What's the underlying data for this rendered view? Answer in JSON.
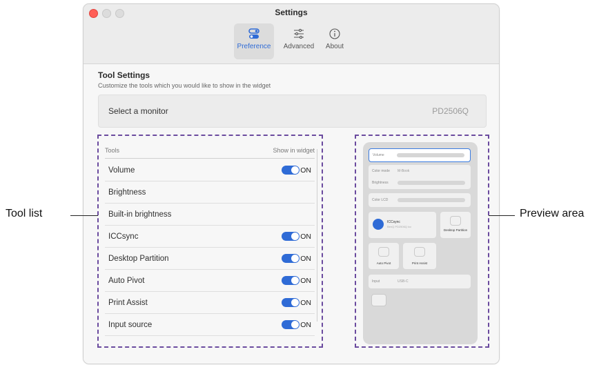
{
  "window": {
    "title": "Settings"
  },
  "tabs": [
    {
      "label": "Preference",
      "icon": "toggle-icon",
      "active": true
    },
    {
      "label": "Advanced",
      "icon": "sliders-icon",
      "active": false
    },
    {
      "label": "About",
      "icon": "info-icon",
      "active": false
    }
  ],
  "tool_settings": {
    "heading": "Tool Settings",
    "subtitle": "Customize the tools which you would like to show in the widget",
    "monitor_label": "Select a monitor",
    "monitor_value": "PD2506Q"
  },
  "tool_list": {
    "col_tools": "Tools",
    "col_show": "Show in widget",
    "on_label": "ON",
    "rows": [
      {
        "label": "Volume",
        "enabled": true
      },
      {
        "label": "Brightness",
        "enabled": false
      },
      {
        "label": "Built-in brightness",
        "enabled": false
      },
      {
        "label": "ICCsync",
        "enabled": true
      },
      {
        "label": "Desktop Partition",
        "enabled": true
      },
      {
        "label": "Auto Pivot",
        "enabled": true
      },
      {
        "label": "Print Assist",
        "enabled": true
      },
      {
        "label": "Input source",
        "enabled": true
      }
    ]
  },
  "preview": {
    "volume_label": "Volume",
    "color_mode_label": "Color mode",
    "color_mode_value": "M-Book",
    "brightness_label": "Brightness",
    "color_lcd_label": "Color LCD",
    "iccsync_label": "ICCsync",
    "iccsync_sub": "BenQ PD2506Q Icc",
    "desktop_partition_label": "Desktop Partition",
    "auto_pivot_label": "Auto Pivot",
    "print_assist_label": "Print Assist",
    "input_label": "Input",
    "input_value": "USB-C"
  },
  "callouts": {
    "left": "Tool list",
    "right": "Preview area"
  },
  "colors": {
    "accent": "#2f6bd6",
    "highlight": "#6a4a9e",
    "close": "#ff5f57"
  }
}
